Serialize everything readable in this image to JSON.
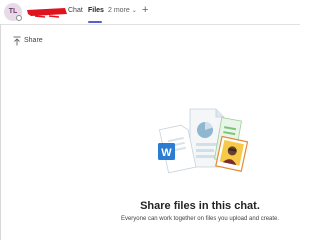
{
  "header": {
    "avatar_initials": "TL",
    "redaction_color": "#e0141e",
    "tabs": [
      {
        "label": "Chat",
        "selected": false
      },
      {
        "label": "Files",
        "selected": true
      },
      {
        "label": "2 more",
        "selected": false
      }
    ],
    "add_tab_icon": "plus-icon",
    "more_icon": "chevron-down-icon",
    "accent_color": "#5b5fc7"
  },
  "toolbar": {
    "share_label": "Share",
    "share_icon": "upload-share-icon"
  },
  "empty_state": {
    "title": "Share files in this chat.",
    "subtitle": "Everyone can work together on files you upload and create.",
    "illustration_icons": [
      "word-document-icon",
      "chart-document-icon",
      "image-file-icon"
    ]
  }
}
